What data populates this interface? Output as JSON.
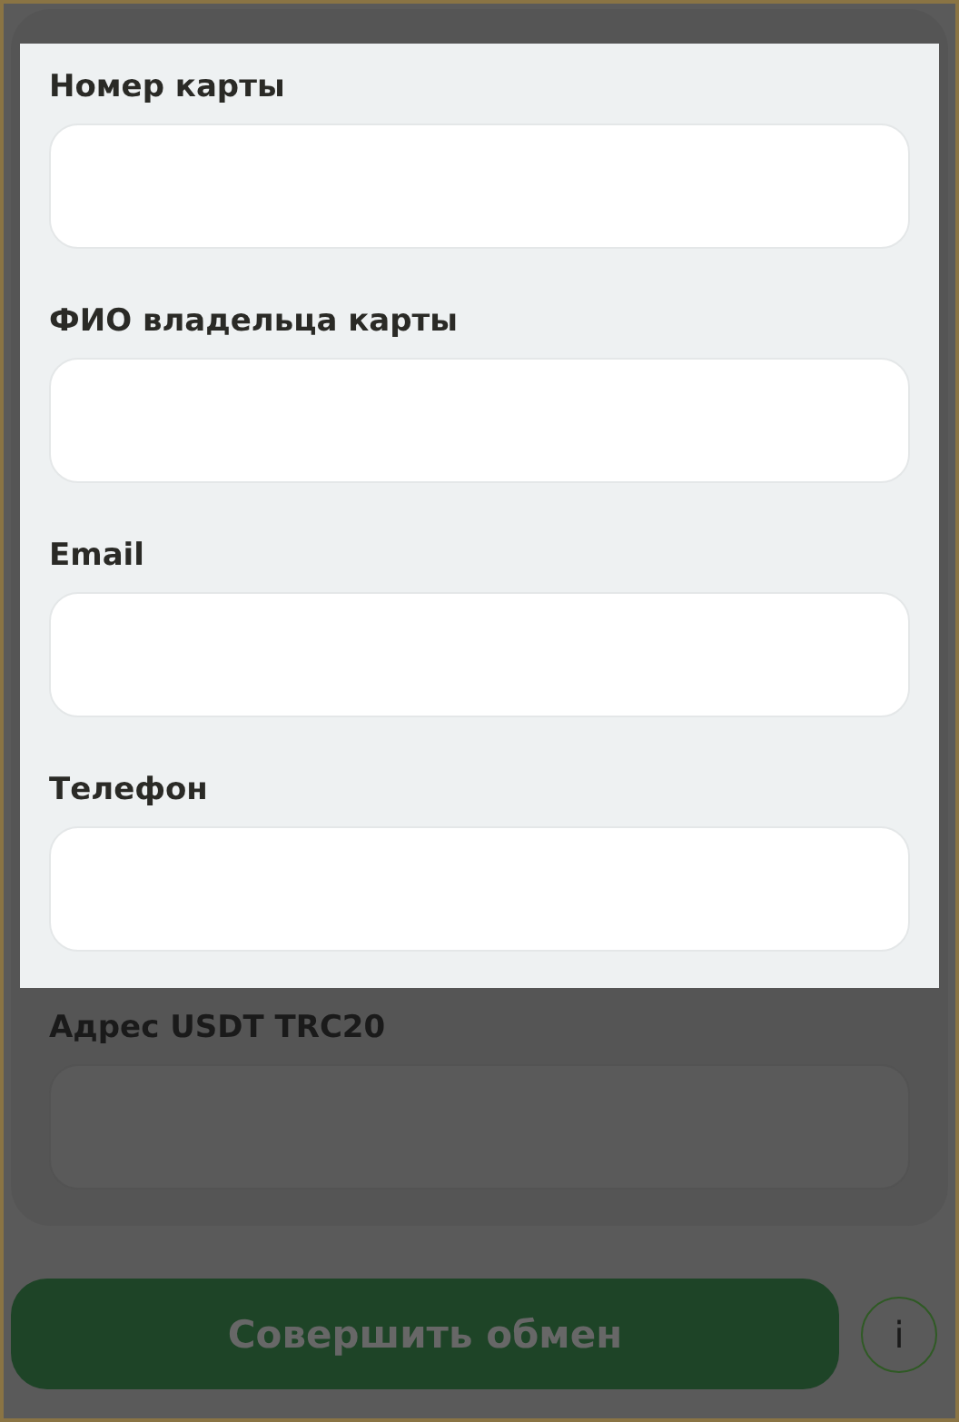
{
  "form": {
    "fields": [
      {
        "label": "Номер карты",
        "highlighted": true
      },
      {
        "label": "ФИО владельца карты",
        "highlighted": true
      },
      {
        "label": "Email",
        "highlighted": true
      },
      {
        "label": "Телефон",
        "highlighted": true
      },
      {
        "label": "Адрес USDT TRC20",
        "highlighted": false
      }
    ]
  },
  "submit_button": {
    "label": "Совершить обмен"
  },
  "info_button": {
    "label": "i"
  }
}
